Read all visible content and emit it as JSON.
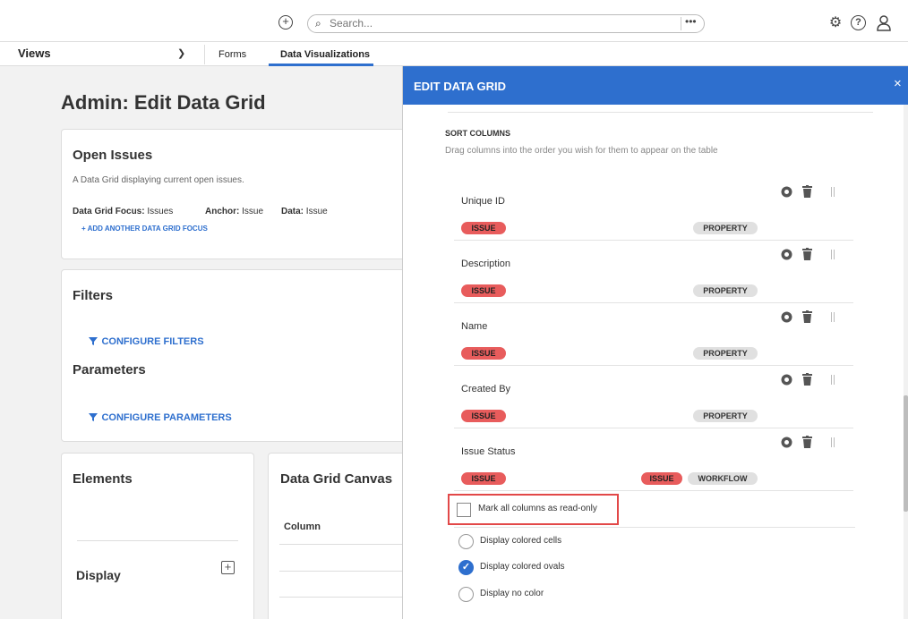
{
  "search": {
    "placeholder": "Search..."
  },
  "icons": {
    "add": "plus-circle-icon",
    "search": "magnifier-icon",
    "more": "ellipsis-icon",
    "settings": "gear-icon",
    "help": "question-icon",
    "user": "user-icon",
    "close": "close-icon",
    "view": "eye-icon",
    "delete": "trash-icon",
    "drag": "drag-handle-icon",
    "filter": "funnel-icon",
    "expand": "plus-square-icon",
    "check": "checkmark-icon"
  },
  "nav": {
    "views_label": "Views",
    "tabs": [
      {
        "label": "Forms"
      },
      {
        "label": "Data Visualizations"
      }
    ]
  },
  "page": {
    "title": "Admin: Edit Data Grid",
    "info_card": {
      "title": "Open Issues",
      "description": "A Data Grid displaying current open issues.",
      "focus_label": "Data Grid Focus:",
      "focus_value": "Issues",
      "anchor_label": "Anchor:",
      "anchor_value": "Issue",
      "data_label": "Data:",
      "data_value": "Issue",
      "add_focus_link": "+ ADD ANOTHER DATA GRID FOCUS"
    },
    "filters_card": {
      "filters_title": "Filters",
      "configure_filters": "CONFIGURE FILTERS",
      "parameters_title": "Parameters",
      "configure_parameters": "CONFIGURE PARAMETERS"
    },
    "elements_card": {
      "title": "Elements",
      "display_label": "Display"
    },
    "canvas_card": {
      "title": "Data Grid Canvas",
      "column_header": "Column"
    }
  },
  "panel": {
    "title": "EDIT DATA GRID",
    "close_symbol": "×",
    "sort_title": "SORT COLUMNS",
    "sort_subtitle": "Drag columns into the order you wish for them to appear on the table",
    "columns": [
      {
        "name": "Unique ID",
        "badge": "ISSUE",
        "type_badges": [
          "PROPERTY"
        ]
      },
      {
        "name": "Description",
        "badge": "ISSUE",
        "type_badges": [
          "PROPERTY"
        ]
      },
      {
        "name": "Name",
        "badge": "ISSUE",
        "type_badges": [
          "PROPERTY"
        ]
      },
      {
        "name": "Created By",
        "badge": "ISSUE",
        "type_badges": [
          "PROPERTY"
        ]
      },
      {
        "name": "Issue Status",
        "badge": "ISSUE",
        "type_badges": [
          "ISSUE",
          "WORKFLOW"
        ]
      }
    ],
    "readonly_label": "Mark all columns as read-only",
    "readonly_checked": false,
    "color_options": [
      {
        "label": "Display colored cells",
        "checked": false
      },
      {
        "label": "Display colored ovals",
        "checked": true
      },
      {
        "label": "Display no color",
        "checked": false
      }
    ]
  }
}
